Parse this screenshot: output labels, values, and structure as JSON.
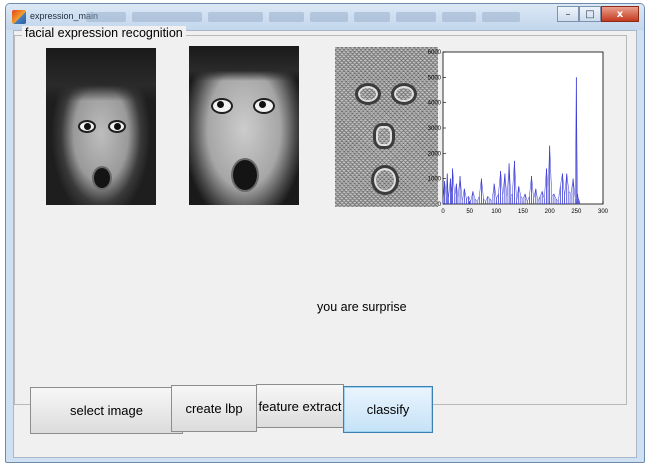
{
  "window": {
    "title": "expression_main",
    "close_glyph": "x",
    "minimize_glyph": "–",
    "maximize_glyph": "□"
  },
  "panel": {
    "title": "facial expression recognition"
  },
  "images": [
    {
      "name": "input-face-image",
      "description_icon": "face-photo"
    },
    {
      "name": "cropped-face-image",
      "description_icon": "face-photo"
    },
    {
      "name": "lbp-image",
      "description_icon": "lbp-texture"
    }
  ],
  "result_text": "you are surprise",
  "buttons": {
    "select_image": "select image",
    "create_lbp": "create  lbp",
    "feature_extract": "feature extract",
    "classify": "classify"
  },
  "chart_data": {
    "type": "line",
    "xlim": [
      0,
      300
    ],
    "ylim": [
      0,
      6000
    ],
    "xticks": [
      0,
      50,
      100,
      150,
      200,
      250,
      300
    ],
    "yticks": [
      0,
      1000,
      2000,
      3000,
      4000,
      5000,
      6000
    ],
    "series_color": "#3b3bd6",
    "x": [
      0,
      3,
      6,
      8,
      10,
      14,
      16,
      18,
      22,
      25,
      28,
      32,
      36,
      40,
      44,
      48,
      52,
      56,
      60,
      64,
      68,
      72,
      76,
      80,
      84,
      88,
      92,
      96,
      100,
      104,
      108,
      112,
      116,
      120,
      124,
      127,
      130,
      134,
      138,
      142,
      146,
      150,
      154,
      158,
      162,
      166,
      170,
      174,
      178,
      182,
      186,
      190,
      194,
      197,
      200,
      204,
      208,
      212,
      216,
      220,
      224,
      228,
      232,
      236,
      240,
      244,
      248,
      250,
      252,
      254,
      256
    ],
    "y": [
      100,
      900,
      300,
      1200,
      200,
      1000,
      400,
      1400,
      300,
      800,
      200,
      1100,
      100,
      600,
      200,
      300,
      100,
      500,
      200,
      100,
      300,
      1000,
      200,
      100,
      300,
      200,
      100,
      800,
      200,
      400,
      1300,
      300,
      1200,
      200,
      1600,
      300,
      400,
      1700,
      100,
      700,
      300,
      200,
      400,
      100,
      300,
      1100,
      200,
      600,
      100,
      300,
      500,
      200,
      1400,
      600,
      2300,
      300,
      400,
      200,
      100,
      700,
      1200,
      300,
      1200,
      500,
      400,
      1000,
      200,
      5000,
      400,
      200,
      100
    ]
  }
}
